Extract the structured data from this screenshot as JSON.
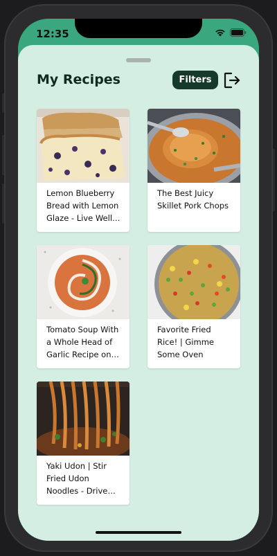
{
  "status_bar": {
    "time": "12:35"
  },
  "header": {
    "title": "My Recipes",
    "filters_label": "Filters"
  },
  "recipes": [
    {
      "title": "Lemon Blueberry Bread with Lemon Glaze - Live Well B..."
    },
    {
      "title": "The Best Juicy Skillet Pork Chops"
    },
    {
      "title": "Tomato Soup With a Whole Head of Garlic Recipe on F..."
    },
    {
      "title": "Favorite Fried Rice! | Gimme Some Oven"
    },
    {
      "title": "Yaki Udon | Stir Fried Udon Noodles - Drive Me Hungry"
    }
  ],
  "colors": {
    "accent": "#3aa77e",
    "sheet": "#d4eee3",
    "button": "#153a2b"
  },
  "icons": [
    "wifi-icon",
    "battery-icon",
    "logout-icon"
  ]
}
